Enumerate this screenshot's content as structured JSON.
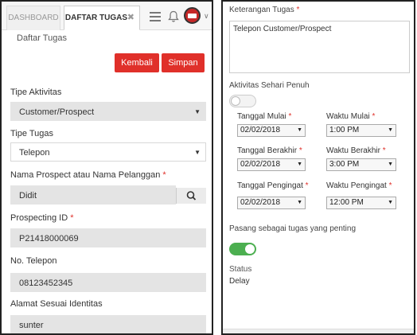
{
  "header": {
    "tabs": [
      {
        "label": "DASHBOARD"
      },
      {
        "label": "DAFTAR TUGAS",
        "close_glyph": "✖"
      }
    ],
    "icons": [
      "menu-icon",
      "bell-icon",
      "avatar-icon",
      "chevron-down-icon"
    ]
  },
  "page_heading": "Daftar Tugas",
  "actions": {
    "back_label": "Kembali",
    "save_label": "Simpan",
    "button_color": "#e0302a"
  },
  "form": {
    "tipe_aktivitas": {
      "label": "Tipe Aktivitas",
      "value": "Customer/Prospect"
    },
    "tipe_tugas": {
      "label": "Tipe Tugas",
      "value": "Telepon"
    },
    "nama_prospect": {
      "label": "Nama Prospect atau Nama Pelanggan",
      "required": "*",
      "value": "Didit"
    },
    "prospecting_id": {
      "label": "Prospecting ID",
      "required": "*",
      "value": "P21418000069"
    },
    "no_telepon": {
      "label": "No. Telepon",
      "value": "08123452345"
    },
    "alamat": {
      "label": "Alamat Sesuai Identitas",
      "value": "sunter"
    }
  },
  "detail": {
    "keterangan": {
      "label": "Keterangan Tugas",
      "required": "*",
      "value": "Telepon Customer/Prospect"
    },
    "aktivitas_sehari": {
      "label": "Aktivitas Sehari Penuh",
      "on": false
    },
    "tanggal_mulai": {
      "label": "Tanggal Mulai",
      "required": "*",
      "value": "02/02/2018"
    },
    "waktu_mulai": {
      "label": "Waktu Mulai",
      "required": "*",
      "value": "1:00 PM"
    },
    "tanggal_berakhir": {
      "label": "Tanggal Berakhir",
      "required": "*",
      "value": "02/02/2018"
    },
    "waktu_berakhir": {
      "label": "Waktu Berakhir",
      "required": "*",
      "value": "3:00 PM"
    },
    "tanggal_pengingat": {
      "label": "Tanggal Pengingat",
      "required": "*",
      "value": "02/02/2018"
    },
    "waktu_pengingat": {
      "label": "Waktu Pengingat",
      "required": "*",
      "value": "12:00 PM"
    },
    "tugas_penting": {
      "label": "Pasang sebagai tugas yang penting",
      "on": true
    },
    "status": {
      "label": "Status",
      "value": "Delay"
    }
  },
  "glyphs": {
    "select_arrow": "▼",
    "chevron": "∨"
  },
  "colors": {
    "accent": "#e0302a",
    "toggle_on": "#4caf50"
  }
}
